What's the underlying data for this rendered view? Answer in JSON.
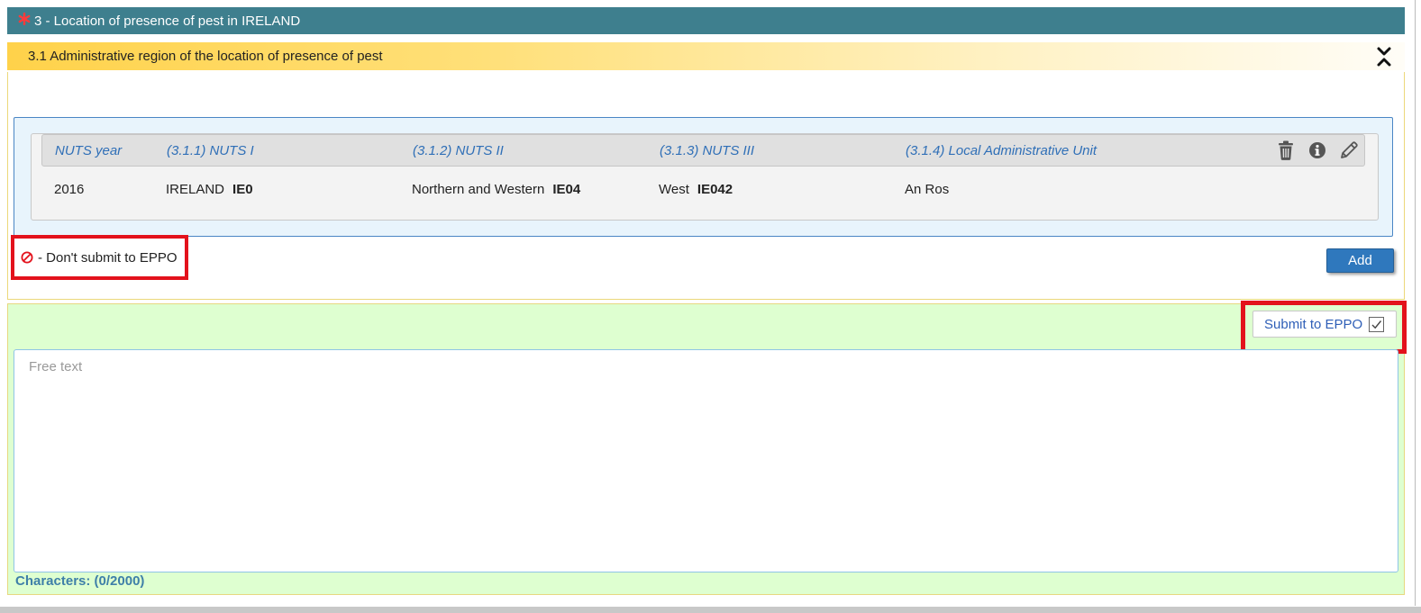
{
  "section": {
    "required_icon": "asterisk-icon",
    "title": "3 - Location of presence of pest in IRELAND"
  },
  "subsection": {
    "title": "3.1 Administrative region of the location of presence of pest",
    "collapse_icon": "collapse-chevrons-icon"
  },
  "table": {
    "headers": {
      "nuts_year": "NUTS year",
      "nuts1": "(3.1.1) NUTS I",
      "nuts2": "(3.1.2) NUTS II",
      "nuts3": "(3.1.3) NUTS III",
      "lau": "(3.1.4) Local Administrative Unit"
    },
    "row_actions": [
      "trash-icon",
      "info-icon",
      "pencil-icon"
    ],
    "row": {
      "nuts_year": "2016",
      "nuts1_name": "IRELAND",
      "nuts1_code": "IE0",
      "nuts2_name": "Northern and Western",
      "nuts2_code": "IE04",
      "nuts3_name": "West",
      "nuts3_code": "IE042",
      "lau": "An Ros"
    }
  },
  "dont_submit": {
    "icon": "no-entry-icon",
    "label": "- Don't submit to EPPO"
  },
  "add_button": "Add",
  "submit_eppo": {
    "label": "Submit to EPPO",
    "checked": true
  },
  "free_text": {
    "placeholder": "Free text",
    "value": ""
  },
  "characters": "Characters: (0/2000)",
  "colors": {
    "section_header": "#3e7f8e",
    "subsection_header": "#ffd24a",
    "highlight_border": "#e3121c",
    "green_panel": "#deffd0",
    "add_button": "#2f78bd",
    "header_text_blue": "#2f6fb7"
  }
}
